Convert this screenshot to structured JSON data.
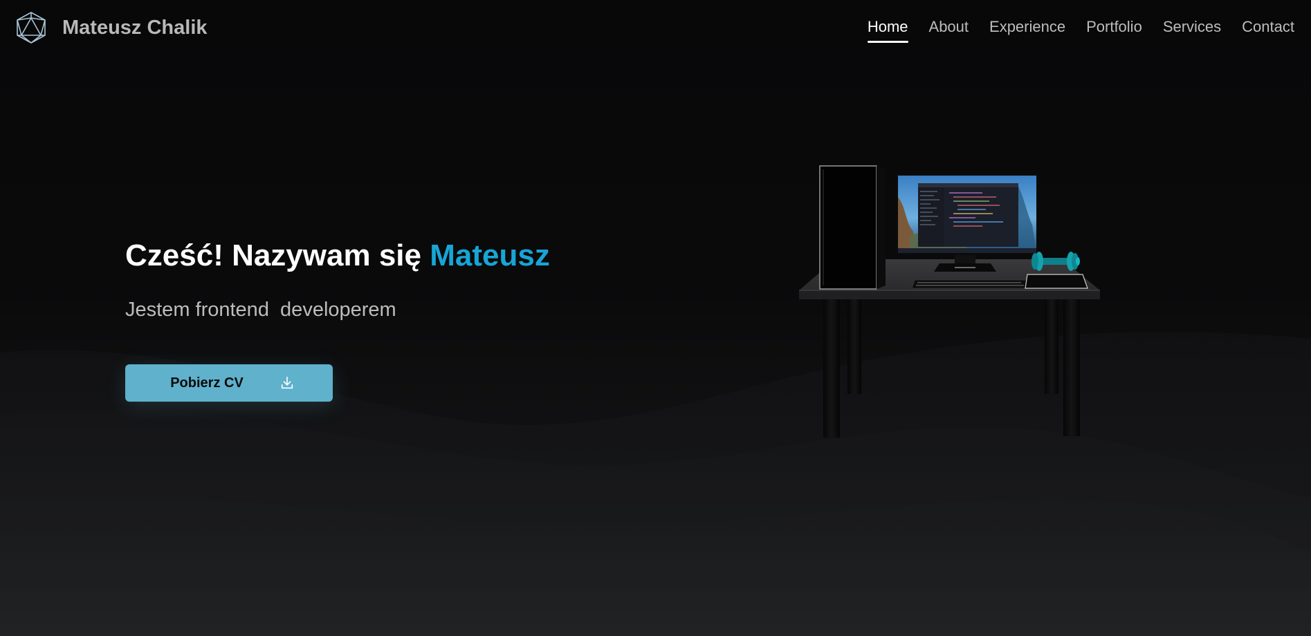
{
  "header": {
    "brand_name": "Mateusz Chalik",
    "logo_icon": "icosahedron-icon",
    "nav": [
      {
        "label": "Home",
        "active": true
      },
      {
        "label": "About",
        "active": false
      },
      {
        "label": "Experience",
        "active": false
      },
      {
        "label": "Portfolio",
        "active": false
      },
      {
        "label": "Services",
        "active": false
      },
      {
        "label": "Contact",
        "active": false
      }
    ]
  },
  "hero": {
    "greeting": "Cześć! Nazywam się ",
    "name": "Mateusz",
    "subtitle": "Jestem frontend  developerem",
    "cv_button": {
      "label": "Pobierz CV",
      "icon": "download-icon"
    }
  },
  "colors": {
    "accent": "#18a5d6",
    "button": "#5fb1cc",
    "background": "#0a0a0b",
    "nav_text": "#bdbdbd",
    "nav_active": "#ffffff"
  },
  "scene": {
    "illustration": "3d-desk-setup",
    "objects": [
      "pc-tower-icon",
      "monitor-icon",
      "keyboard-icon",
      "dumbbell-icon",
      "mousepad-icon",
      "desk-icon"
    ]
  }
}
